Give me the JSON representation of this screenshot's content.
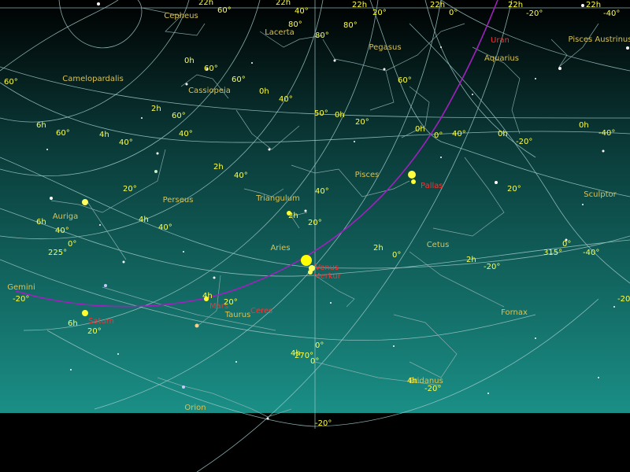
{
  "colors": {
    "sky_top": "#000000",
    "sky_mid": "#0a3a38",
    "sky_horizon": "#1a8f86",
    "ground": "#000000",
    "grid": "#9fc9c9",
    "ecliptic": "#a020c0",
    "constellation_label": "#d9c255",
    "coordinate_label": "#ffff40",
    "planet_label": "#ff3030"
  },
  "constellations": [
    {
      "name": "Cepheus",
      "key": "cepheus"
    },
    {
      "name": "Lacerta",
      "key": "lacerta"
    },
    {
      "name": "Pegasus",
      "key": "pegasus"
    },
    {
      "name": "Aquarius",
      "key": "aquarius"
    },
    {
      "name": "Pisces Austrinus",
      "key": "piscis-austrinus"
    },
    {
      "name": "Camelopardalis",
      "key": "camelopardalis"
    },
    {
      "name": "Cassiopeia",
      "key": "cassiopeia"
    },
    {
      "name": "Pisces",
      "key": "pisces"
    },
    {
      "name": "Sculptor",
      "key": "sculptor"
    },
    {
      "name": "Perseus",
      "key": "perseus"
    },
    {
      "name": "Triangulum",
      "key": "triangulum"
    },
    {
      "name": "Auriga",
      "key": "auriga"
    },
    {
      "name": "Aries",
      "key": "aries"
    },
    {
      "name": "Cetus",
      "key": "cetus"
    },
    {
      "name": "Gemini",
      "key": "gemini"
    },
    {
      "name": "Taurus",
      "key": "taurus"
    },
    {
      "name": "Fornax",
      "key": "fornax"
    },
    {
      "name": "Eridanus",
      "key": "eridanus"
    },
    {
      "name": "Orion",
      "key": "orion"
    }
  ],
  "planets": [
    {
      "name": "Uran",
      "key": "uranus"
    },
    {
      "name": "Pallas",
      "key": "pallas"
    },
    {
      "name": "Venus",
      "key": "venus"
    },
    {
      "name": "Merkur",
      "key": "mercury"
    },
    {
      "name": "Saturn",
      "key": "saturn"
    },
    {
      "name": "Mars",
      "key": "mars"
    },
    {
      "name": "Ceres",
      "key": "ceres"
    }
  ],
  "coordinate_labels": [
    "22h",
    "22h",
    "22h",
    "22h",
    "22h",
    "22h",
    "60°",
    "40°",
    "20°",
    "0°",
    "-20°",
    "-40°",
    "80°",
    "80°",
    "80°",
    "0h",
    "60°",
    "60°",
    "0h",
    "40°",
    "60°",
    "60°",
    "40°",
    "50°",
    "0h",
    "20°",
    "0h",
    "0h",
    "0h",
    "0°",
    "40°",
    "-20°",
    "-40°",
    "6h",
    "4h",
    "2h",
    "60°",
    "60°",
    "40°",
    "40°",
    "40°",
    "20°",
    "20°",
    "2h",
    "4h",
    "40°",
    "20°",
    "2h",
    "2h",
    "0°",
    "-20°",
    "6h",
    "40°",
    "0°",
    "225°",
    "315°",
    "0°",
    "-40°",
    "-20°",
    "-20°",
    "4h",
    "20°",
    "6h",
    "20°",
    "4h",
    "0°",
    "270°",
    "0°",
    "4h",
    "-20°",
    "-20°",
    "2h"
  ]
}
